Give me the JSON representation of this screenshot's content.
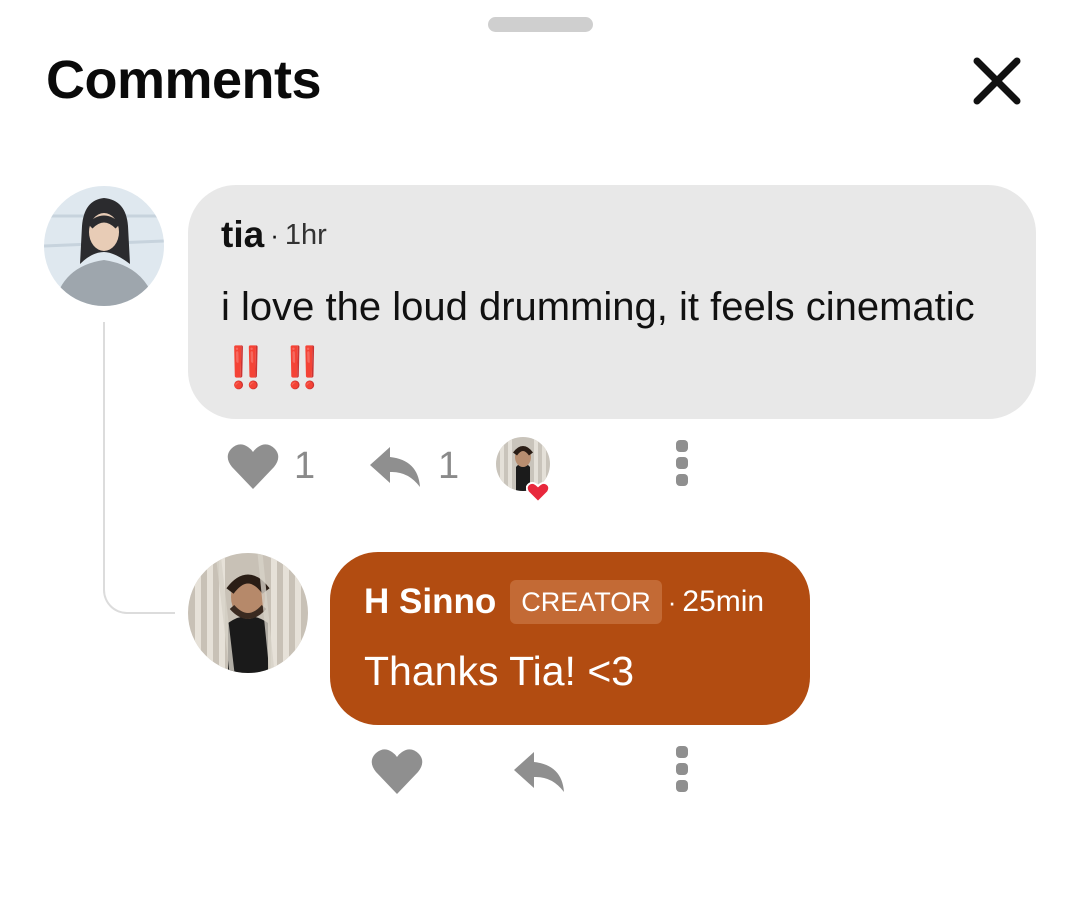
{
  "header": {
    "title": "Comments",
    "close_icon": "close-icon"
  },
  "comments": [
    {
      "author": "tia",
      "separator": "·",
      "time": "1hr",
      "text": "i love the loud drumming, it feels cinematic",
      "emoji": "‼️ ‼️",
      "likes": "1",
      "replies": "1",
      "liked_by_creator": true
    }
  ],
  "reply": {
    "author": "H Sinno",
    "badge": "CREATOR",
    "separator": "·",
    "time": "25min",
    "text": "Thanks Tia! <3"
  },
  "colors": {
    "creator_bubble": "#b24c11",
    "comment_bubble": "#e8e8e8",
    "like_heart": "#e8283c",
    "action_gray": "#8f8f8f"
  }
}
